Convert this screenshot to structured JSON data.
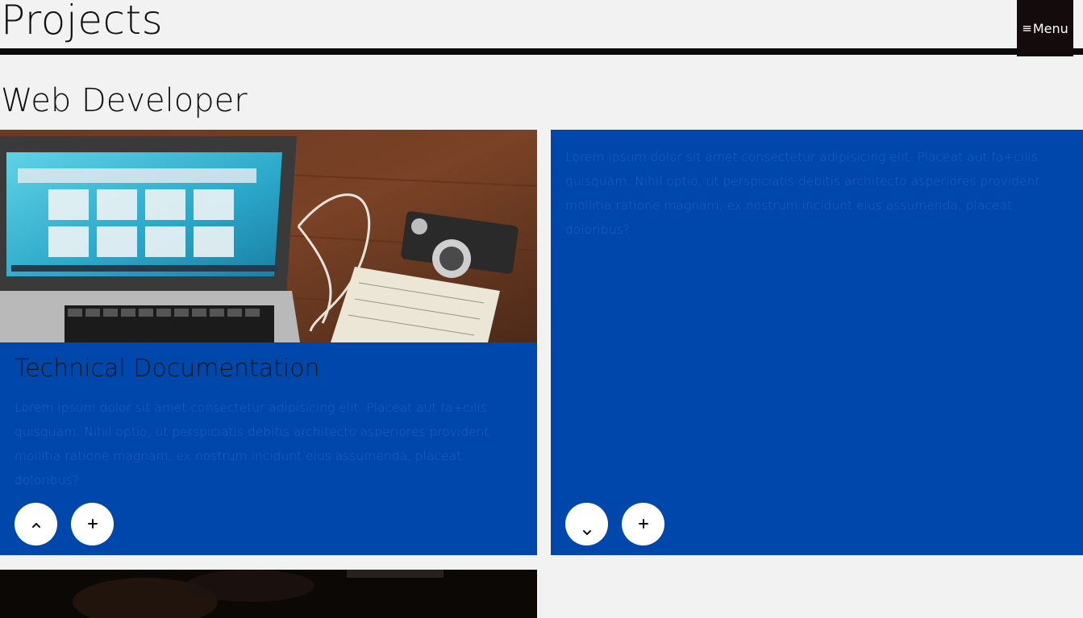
{
  "header": {
    "title": "Projects",
    "menu_icon": "≡",
    "menu_label": "Menu"
  },
  "section": {
    "title": "Web Developer"
  },
  "cards": [
    {
      "title": "Technical Documentation",
      "text": "Lorem ipsum dolor sit amet consectetur adipisicing elit. Placeat aut fa+cilis quisquam. Nihil optio, ut perspiciatis debitis architecto asperiores provident mollitia ratione magnam, ex nostrum incidunt eius assumenda, placeat doloribus?",
      "toggle_icon": "chevron-up-icon",
      "expand_icon": "plus-icon"
    },
    {
      "text": "Lorem ipsum dolor sit amet consectetur adipisicing elit. Placeat aut fa+cilis quisquam. Nihil optio, ut perspiciatis debitis architecto asperiores provident mollitia ratione magnam, ex nostrum incidunt eius assumenda, placeat doloribus?",
      "toggle_icon": "chevron-down-icon",
      "expand_icon": "plus-icon"
    }
  ],
  "colors": {
    "card_background": "#0047ab",
    "page_background": "#f2f2f2",
    "header_bar": "#0c0a0a",
    "menu_background": "#140c0c"
  }
}
